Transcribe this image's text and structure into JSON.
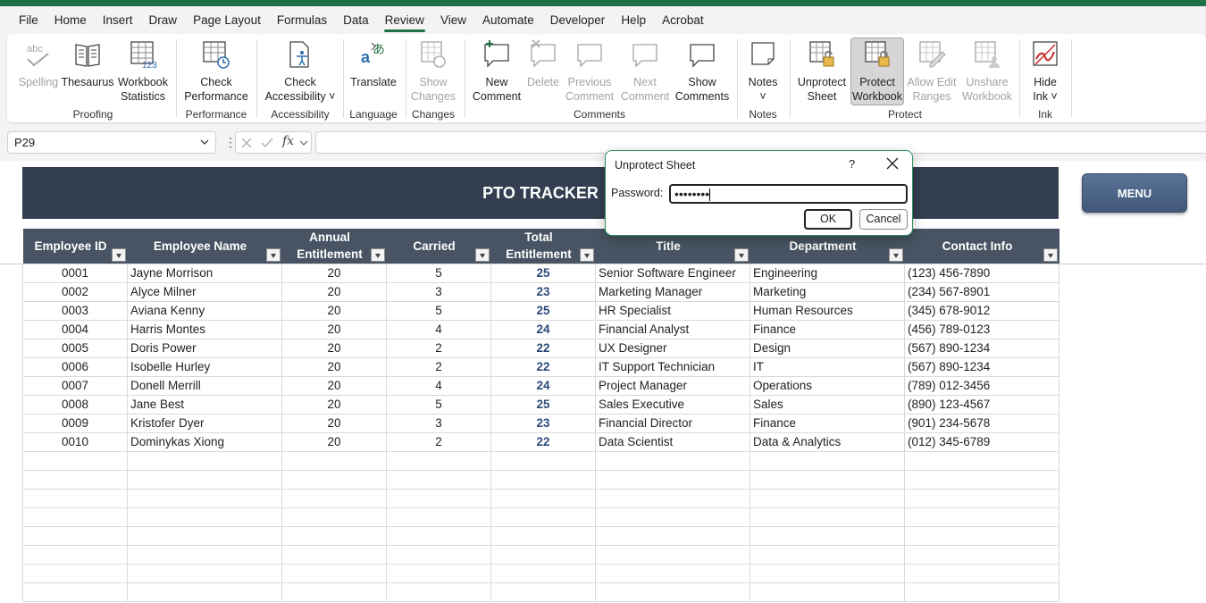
{
  "menubar": [
    "File",
    "Home",
    "Insert",
    "Draw",
    "Page Layout",
    "Formulas",
    "Data",
    "Review",
    "View",
    "Automate",
    "Developer",
    "Help",
    "Acrobat"
  ],
  "ribbon": {
    "spelling": [
      "Spelling"
    ],
    "thesaurus": [
      "Thesaurus"
    ],
    "workbook_stats": [
      "Workbook",
      "Statistics"
    ],
    "check_performance": [
      "Check",
      "Performance"
    ],
    "check_accessibility": [
      "Check",
      "Accessibility ˅"
    ],
    "translate": [
      "Translate"
    ],
    "show_changes": [
      "Show",
      "Changes"
    ],
    "new_comment": [
      "New",
      "Comment"
    ],
    "delete": [
      "Delete"
    ],
    "previous_comment": [
      "Previous",
      "Comment"
    ],
    "next_comment": [
      "Next",
      "Comment"
    ],
    "show_comments": [
      "Show",
      "Comments"
    ],
    "notes": [
      "Notes",
      "˅"
    ],
    "unprotect_sheet": [
      "Unprotect",
      "Sheet"
    ],
    "protect_workbook": [
      "Protect",
      "Workbook"
    ],
    "allow_edit_ranges": [
      "Allow Edit",
      "Ranges"
    ],
    "unshare_workbook": [
      "Unshare",
      "Workbook"
    ],
    "hide_ink": [
      "Hide",
      "Ink ˅"
    ],
    "groups": {
      "proofing": "Proofing",
      "performance": "Performance",
      "accessibility": "Accessibility",
      "language": "Language",
      "changes": "Changes",
      "comments": "Comments",
      "notes": "Notes",
      "protect": "Protect",
      "ink": "Ink"
    }
  },
  "formula_bar": {
    "name_box": "P29",
    "formula": ""
  },
  "sheet": {
    "title": "PTO TRACKER",
    "menu_button": "MENU",
    "headers": [
      [
        "Employee ID"
      ],
      [
        "Employee Name"
      ],
      [
        "Annual",
        "Entitlement"
      ],
      [
        "Carried"
      ],
      [
        "Total",
        "Entitlement"
      ],
      [
        "Title"
      ],
      [
        "Department"
      ],
      [
        "Contact Info"
      ]
    ],
    "rows": [
      [
        "0001",
        "Jayne Morrison",
        "20",
        "5",
        "25",
        "Senior Software Engineer",
        "Engineering",
        "(123) 456-7890"
      ],
      [
        "0002",
        "Alyce Milner",
        "20",
        "3",
        "23",
        "Marketing Manager",
        "Marketing",
        "(234) 567-8901"
      ],
      [
        "0003",
        "Aviana Kenny",
        "20",
        "5",
        "25",
        "HR Specialist",
        "Human Resources",
        "(345) 678-9012"
      ],
      [
        "0004",
        "Harris Montes",
        "20",
        "4",
        "24",
        "Financial Analyst",
        "Finance",
        "(456) 789-0123"
      ],
      [
        "0005",
        "Doris Power",
        "20",
        "2",
        "22",
        "UX Designer",
        "Design",
        "(567) 890-1234"
      ],
      [
        "0006",
        "Isobelle Hurley",
        "20",
        "2",
        "22",
        "IT Support Technician",
        "IT",
        "(567) 890-1234"
      ],
      [
        "0007",
        "Donell Merrill",
        "20",
        "4",
        "24",
        "Project Manager",
        "Operations",
        "(789) 012-3456"
      ],
      [
        "0008",
        "Jane Best",
        "20",
        "5",
        "25",
        "Sales Executive",
        "Sales",
        "(890) 123-4567"
      ],
      [
        "0009",
        "Kristofer Dyer",
        "20",
        "3",
        "23",
        "Financial Director",
        "Finance",
        "(901) 234-5678"
      ],
      [
        "0010",
        "Dominykas Xiong",
        "20",
        "2",
        "22",
        "Data Scientist",
        "Data & Analytics",
        "(012) 345-6789"
      ]
    ],
    "empty_rows": 8
  },
  "dialog": {
    "title": "Unprotect Sheet",
    "help": "?",
    "password_label": "Password:",
    "password_value": "••••••••",
    "ok": "OK",
    "cancel": "Cancel"
  },
  "colors": {
    "excel_green": "#1f7145",
    "banner": "#333f50",
    "header": "#485463",
    "total_text": "#2e4a78"
  }
}
